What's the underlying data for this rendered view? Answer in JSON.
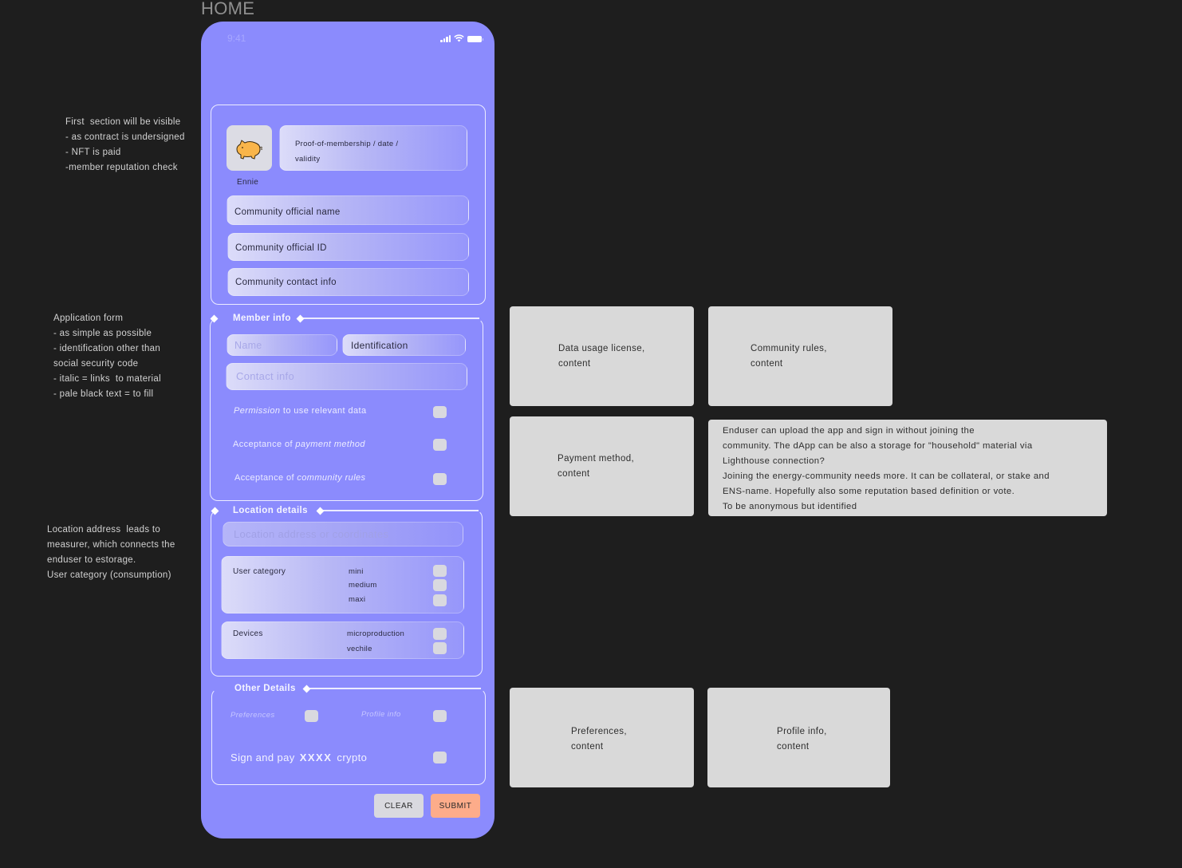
{
  "frame_title": "HOME",
  "notes": {
    "first_section": "First  section will be visible\n- as contract is undersigned\n- NFT is paid\n-member reputation check",
    "application_form": "Application form\n- as simple as possible\n- identification other than\nsocial security code\n- italic = links  to material\n- pale black text = to fill",
    "location": "Location address  leads to\nmeasurer, which connects the\nenduser to estorage.\nUser category (consumption)"
  },
  "status_bar": {
    "time": "9:41",
    "icons": [
      "cellular-signal-icon",
      "wifi-icon",
      "battery-icon"
    ]
  },
  "membership": {
    "avatar_icon": "pig-icon",
    "avatar_name": "Ennie",
    "proof_line1": "Proof-of-membership / date /",
    "proof_line2": "validity",
    "fields": [
      "Community official name",
      "Community official ID",
      "Community contact info"
    ]
  },
  "member_info": {
    "title": "Member info",
    "name_placeholder": "Name",
    "identification_value": "Identification",
    "contact_placeholder": "Contact info",
    "checks": [
      {
        "italic": "Permission",
        "rest": " to use relevant data",
        "italic_first": true
      },
      {
        "plain": "Acceptance of ",
        "italic": "payment method",
        "italic_first": false
      },
      {
        "plain": "Acceptance of ",
        "italic": "community rules",
        "italic_first": false
      }
    ]
  },
  "location_details": {
    "title": "Location details",
    "address_placeholder": "Location address or coordinates",
    "user_category": {
      "label": "User category",
      "options": [
        "mini",
        "medium",
        "maxi"
      ]
    },
    "devices": {
      "label": "Devices",
      "options": [
        "microproduction",
        "vechile"
      ]
    }
  },
  "other_details": {
    "title": "Other Details",
    "preferences": "Preferences",
    "profile_info": "Profile info",
    "sign_prefix": "Sign and pay",
    "sign_amount": "XXXX",
    "sign_suffix": "crypto"
  },
  "buttons": {
    "clear": "CLEAR",
    "submit": "SUBMIT"
  },
  "cards": {
    "data_usage": "Data usage license,\ncontent",
    "community_rules": "Community rules,\ncontent",
    "payment_method": "Payment method,\ncontent",
    "enduser_note": "Enduser can upload the app and sign in without joining the\ncommunity. The dApp can be also a storage for \"household\" material via\nLighthouse connection?\nJoining the energy-community needs more. It can be collateral, or stake and\nENS-name. Hopefully also some reputation based definition or vote.\nTo be anonymous but identified",
    "preferences": "Preferences,\ncontent",
    "profile_info": "Profile info,\ncontent"
  },
  "colors": {
    "canvas": "#1e1e1e",
    "phone": "#8b8bfd",
    "submit": "#fdac8a",
    "clear": "#d9d9df",
    "card": "#d9d9d9"
  }
}
